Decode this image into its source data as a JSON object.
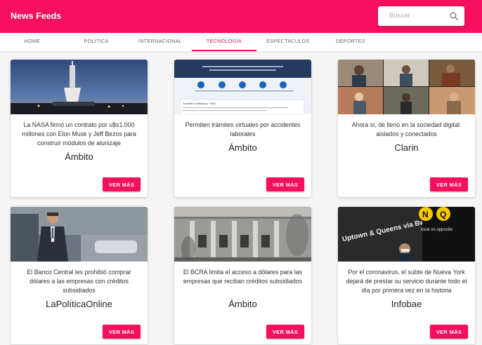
{
  "app": {
    "title": "News Feeds"
  },
  "search": {
    "placeholder": "Buscar",
    "icon": "search-icon"
  },
  "tabs": [
    {
      "label": "HOME",
      "active": false
    },
    {
      "label": "POLITICA",
      "active": false
    },
    {
      "label": "INTERNACIONAL",
      "active": false
    },
    {
      "label": "TECNOLOGIA",
      "active": true
    },
    {
      "label": "ESPECTACULOS",
      "active": false
    },
    {
      "label": "DEPORTES",
      "active": false
    }
  ],
  "cards": [
    {
      "headline": "La NASA firmó un contrato por u$s1.000 millones con Elon Musk y Jeff Bezos para construir módulos de alunizaje",
      "source": "Ámbito",
      "button": "VER MÁS"
    },
    {
      "headline": "Permiten trámites virtuales por accidentes laborales",
      "source": "Ámbito",
      "button": "VER MÁS"
    },
    {
      "headline": "Ahora sí, de lleno en la sociedad digital: aislados y conectados",
      "source": "Clarin",
      "button": "VER MÁS"
    },
    {
      "headline": "El Banco Central les prohibió comprar dólares a las empresas con créditos subsidiados",
      "source": "LaPolíticaOnline",
      "button": "VER MÁS"
    },
    {
      "headline": "El BCRA limita el acceso a dólares para las empresas que reciban créditos subsidiados",
      "source": "Ámbito",
      "button": "VER MÁS"
    },
    {
      "headline": "Por el coronavirus, el subte de Nueva York dejará de prestar su servicio durante todo el día por primera vez en la historia",
      "source": "Infobae",
      "button": "VER MÁS"
    }
  ],
  "thumb_text": {
    "tramites": "Trámites a distancia / TAD",
    "subway_sign": "Uptown & Queens via Bway Express",
    "subway_right": "local on opposite",
    "subway_letters": [
      "N",
      "Q"
    ]
  },
  "colors": {
    "accent": "#f50f5f"
  }
}
